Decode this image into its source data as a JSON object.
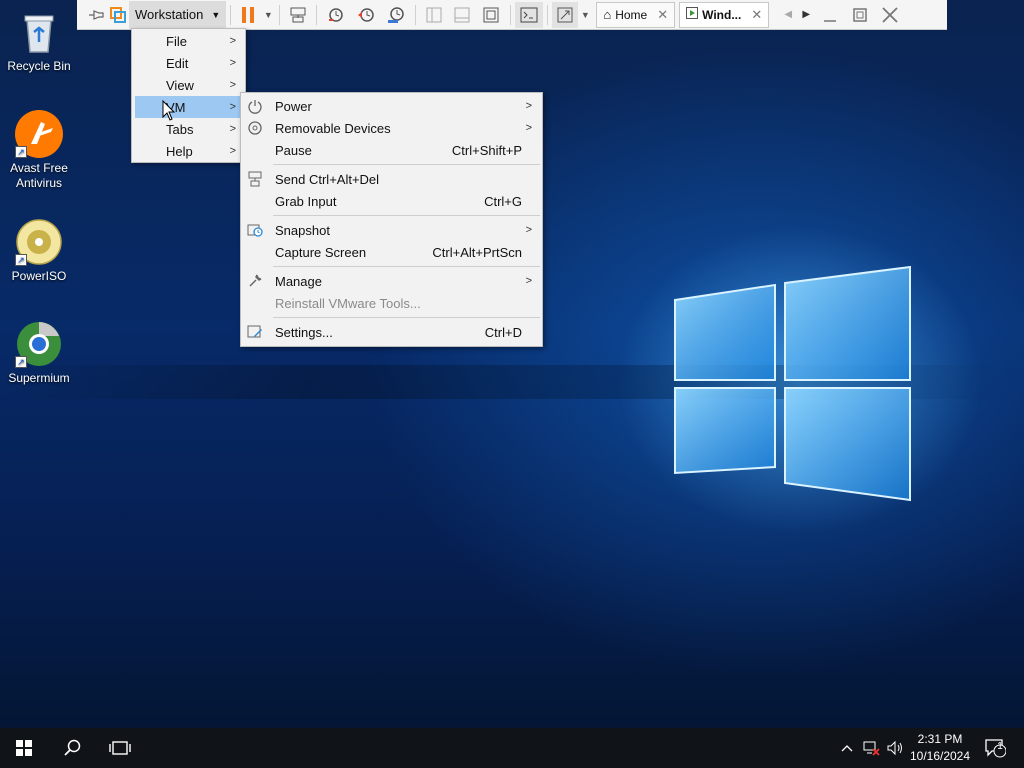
{
  "desktop": {
    "icons": [
      {
        "label": "Recycle Bin"
      },
      {
        "label": "Avast Free Antivirus"
      },
      {
        "label": "PowerISO"
      },
      {
        "label": "Supermium"
      }
    ]
  },
  "toolbar": {
    "workstation_label": "Workstation",
    "tabs": [
      {
        "label": "Home"
      },
      {
        "label": "Wind..."
      }
    ]
  },
  "workstation_menu": {
    "items": [
      {
        "label": "File"
      },
      {
        "label": "Edit"
      },
      {
        "label": "View"
      },
      {
        "label": "VM"
      },
      {
        "label": "Tabs"
      },
      {
        "label": "Help"
      }
    ]
  },
  "vm_menu": {
    "items": [
      {
        "label": "Power",
        "shortcut": "",
        "icon": "power-icon"
      },
      {
        "label": "Removable Devices",
        "shortcut": "",
        "icon": "disc-icon"
      },
      {
        "label": "Pause",
        "shortcut": "Ctrl+Shift+P"
      },
      {
        "label": "Send Ctrl+Alt+Del",
        "shortcut": "",
        "icon": "send-keys-icon"
      },
      {
        "label": "Grab Input",
        "shortcut": "Ctrl+G"
      },
      {
        "label": "Snapshot",
        "shortcut": "",
        "icon": "snapshot-icon"
      },
      {
        "label": "Capture Screen",
        "shortcut": "Ctrl+Alt+PrtScn"
      },
      {
        "label": "Manage",
        "shortcut": "",
        "icon": "wrench-icon"
      },
      {
        "label": "Reinstall VMware Tools...",
        "shortcut": ""
      },
      {
        "label": "Settings...",
        "shortcut": "Ctrl+D",
        "icon": "settings-icon"
      }
    ]
  },
  "taskbar": {
    "time": "2:31 PM",
    "date": "10/16/2024",
    "notification_count": "1"
  },
  "colors": {
    "menu_highlight": "#9cc8f2",
    "pause_orange": "#f07a1a",
    "taskbar": "#101418"
  }
}
